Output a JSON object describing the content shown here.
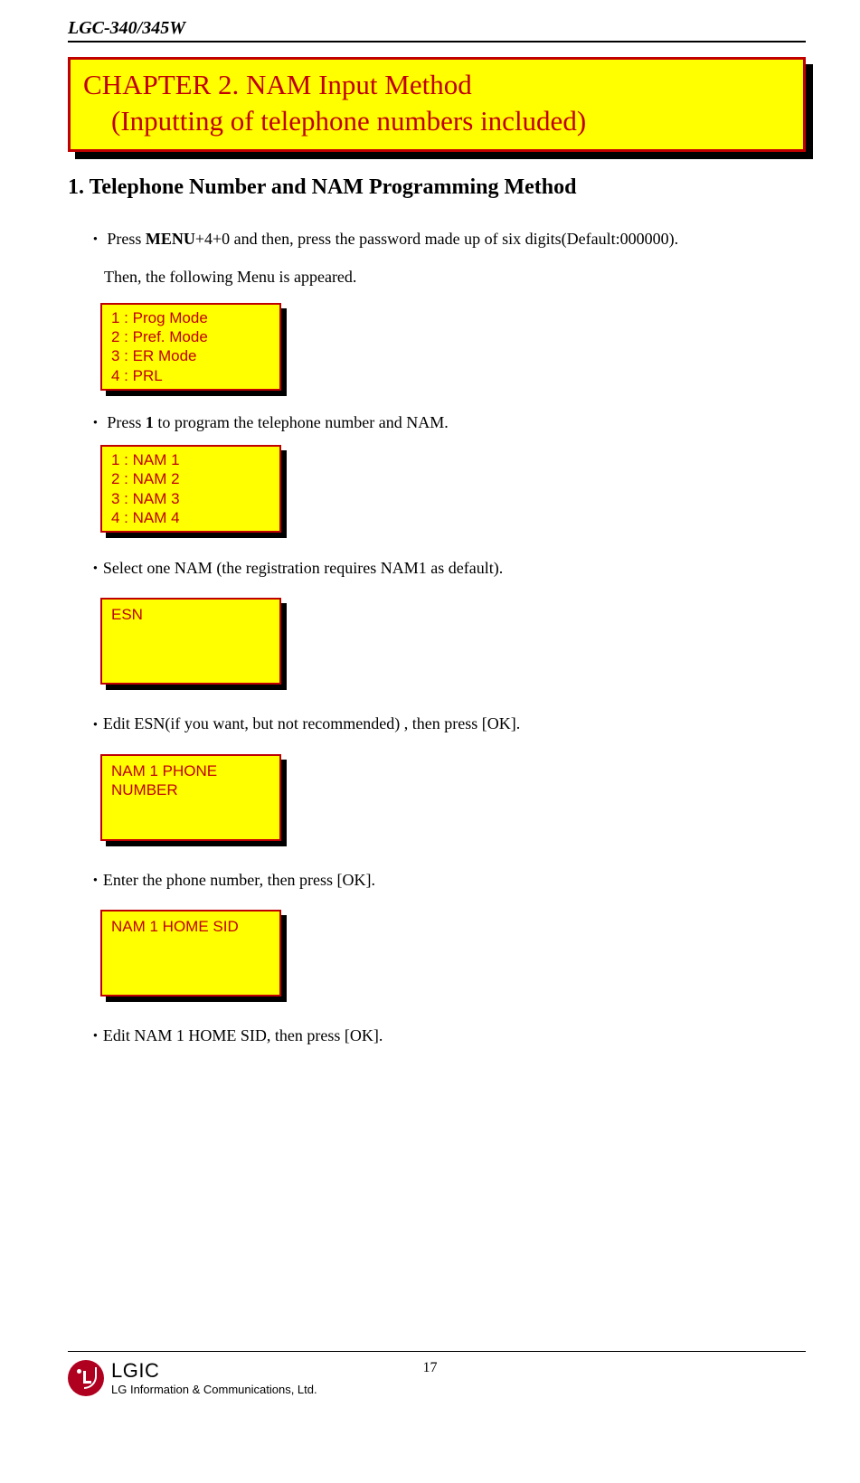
{
  "header": {
    "model": "LGC-340/345W"
  },
  "chapter": {
    "line1": "CHAPTER 2. NAM Input Method",
    "line2_indent": "    (Inputting of telephone numbers included)"
  },
  "section": {
    "title": "1. Telephone Number and NAM Programming Method"
  },
  "steps": {
    "s1_prefix": "Press ",
    "s1_bold": "MENU",
    "s1_suffix": "+4+0 and then, press the password made up of six digits(Default:000000).",
    "s1b": "Then, the following Menu is appeared.",
    "s2_prefix": "Press ",
    "s2_bold": "1",
    "s2_suffix": " to program the telephone number and NAM.",
    "s3": "Select one NAM (the registration requires NAM1 as default).",
    "s4": "Edit ESN(if you want, but not recommended) , then press [OK].",
    "s5": "Enter the phone number, then press [OK].",
    "s6": "Edit NAM 1 HOME SID, then press [OK]."
  },
  "screens": {
    "menu": {
      "l1": "1 : Prog Mode",
      "l2": "2 : Pref. Mode",
      "l3": "3 : ER Mode",
      "l4": "4 : PRL"
    },
    "nam": {
      "l1": "1 : NAM 1",
      "l2": "2 : NAM 2",
      "l3": "3 : NAM 3",
      "l4": "4 : NAM 4"
    },
    "esn": {
      "l1": "ESN"
    },
    "phone": {
      "l1": "NAM 1 PHONE",
      "l2": "NUMBER"
    },
    "sid": {
      "l1": "NAM 1 HOME SID"
    }
  },
  "footer": {
    "lgic": "LGIC",
    "company": "LG Information & Communications, Ltd.",
    "page": "17"
  }
}
